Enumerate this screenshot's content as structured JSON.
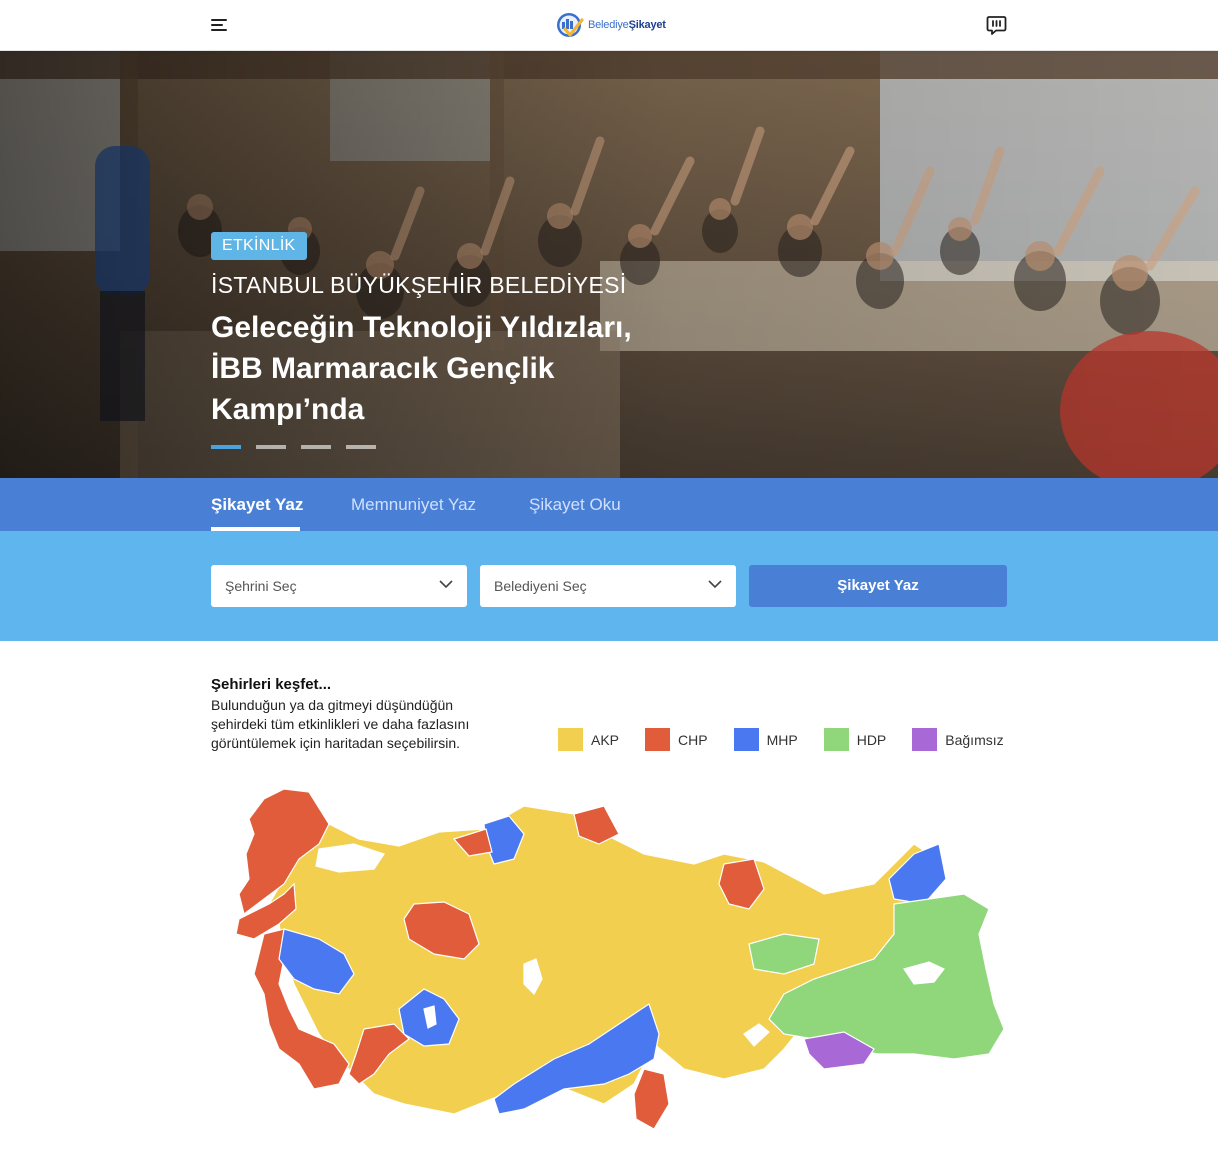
{
  "header": {
    "logo_text_1": "Belediye",
    "logo_text_2": "Şikayet"
  },
  "hero": {
    "badge": "ETKİNLİK",
    "org": "İSTANBUL BÜYÜKŞEHİR BELEDİYESİ",
    "title": "Geleceğin Teknoloji Yıldızları, İBB Marmaracık Gençlik Kampı’nda",
    "slides_total": 4,
    "slide_active": 1
  },
  "tabs": [
    {
      "label": "Şikayet Yaz",
      "active": true
    },
    {
      "label": "Memnuniyet Yaz",
      "active": false
    },
    {
      "label": "Şikayet Oku",
      "active": false
    }
  ],
  "form": {
    "city_select": "Şehrini Seç",
    "municipality_select": "Belediyeni Seç",
    "submit_label": "Şikayet Yaz"
  },
  "explore": {
    "title": "Şehirleri keşfet...",
    "description": "Bulunduğun ya da gitmeyi düşündüğün şehirdeki tüm etkinlikleri ve daha fazlasını görüntülemek için haritadan seçebilirsin."
  },
  "legend": [
    {
      "label": "AKP",
      "color": "#f2cf4e"
    },
    {
      "label": "CHP",
      "color": "#e05c3a"
    },
    {
      "label": "MHP",
      "color": "#4a78f0"
    },
    {
      "label": "HDP",
      "color": "#8fd77a"
    },
    {
      "label": "Bağımsız",
      "color": "#a868d6"
    }
  ],
  "colors": {
    "primary": "#4a7fd6",
    "light_band": "#5fb6ee",
    "badge": "#5fb6e6"
  }
}
